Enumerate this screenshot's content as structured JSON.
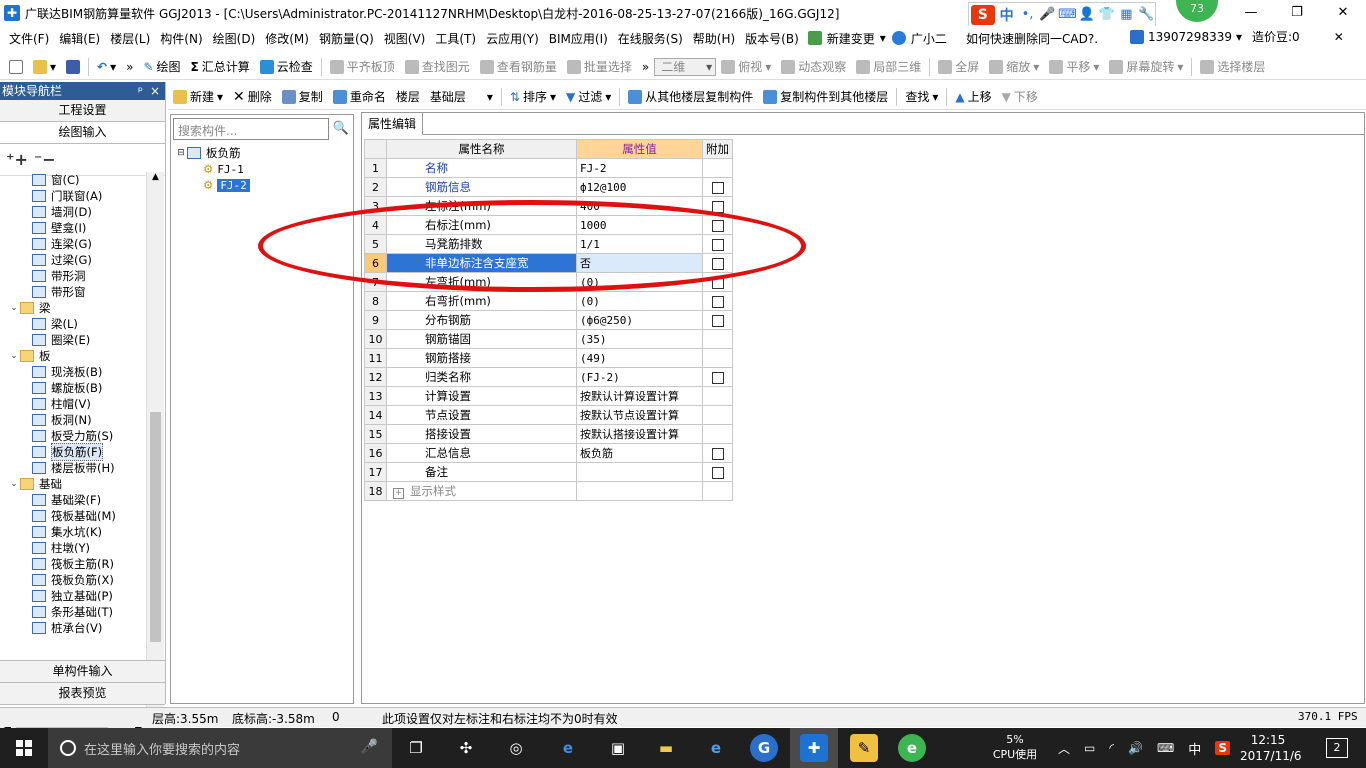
{
  "window": {
    "title": "广联达BIM钢筋算量软件 GGJ2013 - [C:\\Users\\Administrator.PC-20141127NRHM\\Desktop\\白龙村-2016-08-25-13-27-07(2166版)_16G.GGJ12]",
    "badge": "73",
    "ime": {
      "logo": "S",
      "mode": "中",
      "punct": "•,"
    }
  },
  "menu": {
    "items": [
      "文件(F)",
      "编辑(E)",
      "楼层(L)",
      "构件(N)",
      "绘图(D)",
      "修改(M)",
      "钢筋量(Q)",
      "视图(V)",
      "工具(T)",
      "云应用(Y)",
      "BIM应用(I)",
      "在线服务(S)",
      "帮助(H)",
      "版本号(B)"
    ],
    "new_change": "新建变更",
    "assistant": "广小二",
    "help_link": "如何快速删除同一CAD?.",
    "phone": "13907298339",
    "beans": "造价豆:0"
  },
  "toolbar1": {
    "draw": "绘图",
    "sum_calc": "汇总计算",
    "cloud_check": "云检查",
    "flush_top": "平齐板顶",
    "find_elem": "查找图元",
    "view_rebar": "查看钢筋量",
    "batch_select": "批量选择",
    "view_mode": "二维",
    "plan_view": "俯视",
    "dynamic_view": "动态观察",
    "local_3d": "局部三维",
    "fullscreen": "全屏",
    "zoom": "缩放",
    "pan": "平移",
    "rotate": "屏幕旋转",
    "select_floor": "选择楼层"
  },
  "nav": {
    "title": "模块导航栏",
    "pin": "ᵖ",
    "close": "×",
    "project_settings": "工程设置",
    "drawing_input": "绘图输入",
    "single_input": "单构件输入",
    "report_preview": "报表预览",
    "tree": [
      {
        "label": "窗(C)",
        "level": 2,
        "folder": false
      },
      {
        "label": "门联窗(A)",
        "level": 2,
        "folder": false
      },
      {
        "label": "墙洞(D)",
        "level": 2,
        "folder": false
      },
      {
        "label": "壁龛(I)",
        "level": 2,
        "folder": false
      },
      {
        "label": "连梁(G)",
        "level": 2,
        "folder": false
      },
      {
        "label": "过梁(G)",
        "level": 2,
        "folder": false
      },
      {
        "label": "带形洞",
        "level": 2,
        "folder": false
      },
      {
        "label": "带形窗",
        "level": 2,
        "folder": false
      },
      {
        "label": "梁",
        "level": 1,
        "folder": true
      },
      {
        "label": "梁(L)",
        "level": 2,
        "folder": false
      },
      {
        "label": "圈梁(E)",
        "level": 2,
        "folder": false
      },
      {
        "label": "板",
        "level": 1,
        "folder": true
      },
      {
        "label": "现浇板(B)",
        "level": 2,
        "folder": false
      },
      {
        "label": "螺旋板(B)",
        "level": 2,
        "folder": false
      },
      {
        "label": "柱帽(V)",
        "level": 2,
        "folder": false
      },
      {
        "label": "板洞(N)",
        "level": 2,
        "folder": false
      },
      {
        "label": "板受力筋(S)",
        "level": 2,
        "folder": false
      },
      {
        "label": "板负筋(F)",
        "level": 2,
        "folder": false,
        "selected": true
      },
      {
        "label": "楼层板带(H)",
        "level": 2,
        "folder": false
      },
      {
        "label": "基础",
        "level": 1,
        "folder": true
      },
      {
        "label": "基础梁(F)",
        "level": 2,
        "folder": false
      },
      {
        "label": "筏板基础(M)",
        "level": 2,
        "folder": false
      },
      {
        "label": "集水坑(K)",
        "level": 2,
        "folder": false
      },
      {
        "label": "柱墩(Y)",
        "level": 2,
        "folder": false
      },
      {
        "label": "筏板主筋(R)",
        "level": 2,
        "folder": false
      },
      {
        "label": "筏板负筋(X)",
        "level": 2,
        "folder": false
      },
      {
        "label": "独立基础(P)",
        "level": 2,
        "folder": false
      },
      {
        "label": "条形基础(T)",
        "level": 2,
        "folder": false
      },
      {
        "label": "桩承台(V)",
        "level": 2,
        "folder": false
      }
    ]
  },
  "subtoolbar": {
    "new": "新建",
    "delete": "删除",
    "copy": "复制",
    "rename": "重命名",
    "floor_label": "楼层",
    "floor_value": "基础层",
    "sort": "排序",
    "filter": "过滤",
    "copy_from": "从其他楼层复制构件",
    "copy_to": "复制构件到其他楼层",
    "find": "查找",
    "move_up": "上移",
    "move_down": "下移"
  },
  "components": {
    "search_placeholder": "搜索构件...",
    "root": "板负筋",
    "items": [
      "FJ-1",
      "FJ-2"
    ],
    "selected": "FJ-2"
  },
  "properties": {
    "tab": "属性编辑",
    "headers": {
      "name": "属性名称",
      "value": "属性值",
      "extra": "附加"
    },
    "rows": [
      {
        "n": "1",
        "name": "名称",
        "value": "FJ-2",
        "blue": true,
        "cb": false
      },
      {
        "n": "2",
        "name": "钢筋信息",
        "value": "ф12@100",
        "blue": true,
        "cb": true
      },
      {
        "n": "3",
        "name": "左标注(mm)",
        "value": "400",
        "blue": false,
        "cb": true
      },
      {
        "n": "4",
        "name": "右标注(mm)",
        "value": "1000",
        "blue": false,
        "cb": true
      },
      {
        "n": "5",
        "name": "马凳筋排数",
        "value": "1/1",
        "blue": false,
        "cb": true
      },
      {
        "n": "6",
        "name": "非单边标注含支座宽",
        "value": "否",
        "blue": false,
        "cb": true,
        "selected": true
      },
      {
        "n": "7",
        "name": "左弯折(mm)",
        "value": "(0)",
        "blue": false,
        "cb": true
      },
      {
        "n": "8",
        "name": "右弯折(mm)",
        "value": "(0)",
        "blue": false,
        "cb": true
      },
      {
        "n": "9",
        "name": "分布钢筋",
        "value": "(ф6@250)",
        "blue": false,
        "cb": true
      },
      {
        "n": "10",
        "name": "钢筋锚固",
        "value": "(35)",
        "blue": false,
        "cb": false
      },
      {
        "n": "11",
        "name": "钢筋搭接",
        "value": "(49)",
        "blue": false,
        "cb": false
      },
      {
        "n": "12",
        "name": "归类名称",
        "value": "(FJ-2)",
        "blue": false,
        "cb": true
      },
      {
        "n": "13",
        "name": "计算设置",
        "value": "按默认计算设置计算",
        "blue": false,
        "cb": false
      },
      {
        "n": "14",
        "name": "节点设置",
        "value": "按默认节点设置计算",
        "blue": false,
        "cb": false
      },
      {
        "n": "15",
        "name": "搭接设置",
        "value": "按默认搭接设置计算",
        "blue": false,
        "cb": false
      },
      {
        "n": "16",
        "name": "汇总信息",
        "value": "板负筋",
        "blue": false,
        "cb": true
      },
      {
        "n": "17",
        "name": "备注",
        "value": "",
        "blue": false,
        "cb": true
      },
      {
        "n": "18",
        "name": "显示样式",
        "value": "",
        "blue": false,
        "cb": false,
        "expand": true
      }
    ]
  },
  "status": {
    "floor_height": "层高:3.55m",
    "bottom_height": "底标高:-3.58m",
    "zero": "0",
    "hint": "此项设置仅对左标注和右标注均不为0时有效",
    "fps": "370.1 FPS"
  },
  "taskbar": {
    "search_placeholder": "在这里输入你要搜索的内容",
    "cpu_pct": "5%",
    "cpu_label": "CPU使用",
    "ime": "中",
    "time": "12:15",
    "date": "2017/11/6",
    "notif": "2"
  }
}
